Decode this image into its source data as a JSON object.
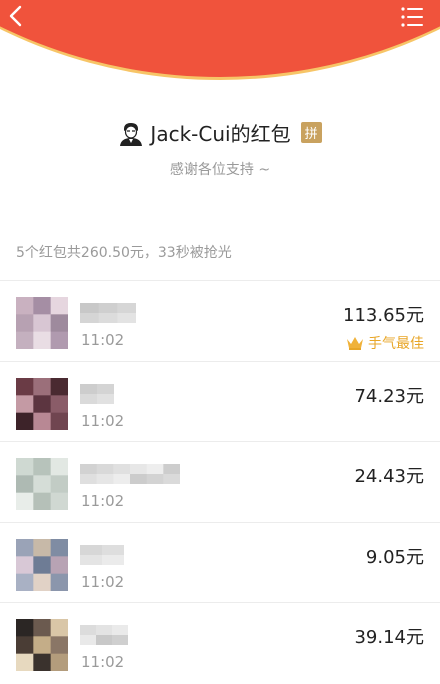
{
  "header": {
    "back_icon": "chevron-left-icon",
    "menu_icon": "list-menu-icon",
    "color": "#f0533c",
    "rim_color": "#f7c567"
  },
  "sender": {
    "name": "Jack-Cui的红包",
    "badge": "拼",
    "avatar_icon": "person-avatar-icon",
    "wishes": "感谢各位支持 ~"
  },
  "summary": "5个红包共260.50元，33秒被抢光",
  "records": [
    {
      "time": "11:02",
      "amount": "113.65元",
      "best_label": "手气最佳",
      "best_icon": "crown-icon",
      "avatar_colors": [
        "#c9b1c0",
        "#a58ea4",
        "#e6d6df",
        "#b7a1b2",
        "#d8c6d3",
        "#9e8a9d",
        "#c4b0bf",
        "#e9dde4",
        "#b09aaf"
      ]
    },
    {
      "time": "11:02",
      "amount": "74.23元",
      "avatar_colors": [
        "#6a3b45",
        "#9b6f7a",
        "#4a2a31",
        "#c49aa4",
        "#5c3540",
        "#8a5c68",
        "#3d2329",
        "#b88894",
        "#704550"
      ]
    },
    {
      "time": "11:02",
      "amount": "24.43元",
      "avatar_colors": [
        "#cfd9d2",
        "#b7c3bb",
        "#e2e8e3",
        "#aebab3",
        "#d5ddd7",
        "#c2ccc5",
        "#e8ede9",
        "#b5c0b8",
        "#d0d8d2"
      ]
    },
    {
      "time": "11:02",
      "amount": "9.05元",
      "avatar_colors": [
        "#9aa3b7",
        "#c7b9a8",
        "#7f8ca3",
        "#d8c8d6",
        "#6e7c95",
        "#b8a3b4",
        "#a9b1c4",
        "#e1d2c6",
        "#8b96ac"
      ]
    },
    {
      "time": "11:02",
      "amount": "39.14元",
      "avatar_colors": [
        "#2b2624",
        "#6b5a4f",
        "#d9c6a7",
        "#4a3d35",
        "#c4ad88",
        "#8a7666",
        "#e7d9bf",
        "#3a322d",
        "#b39c7c"
      ]
    }
  ]
}
